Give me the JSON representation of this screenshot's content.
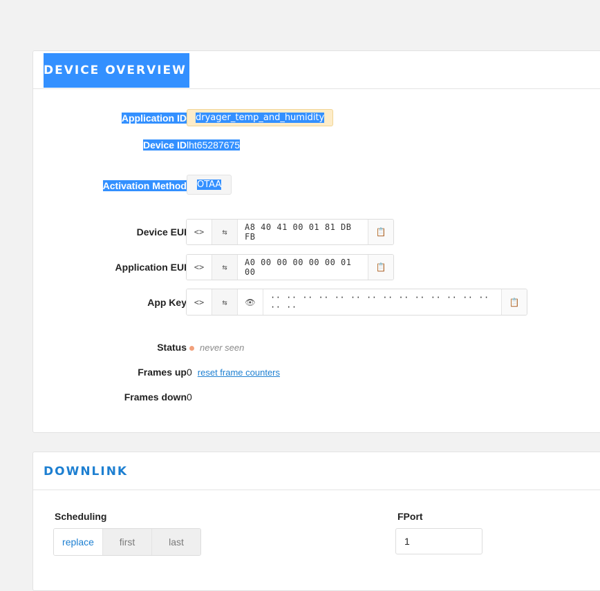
{
  "overview": {
    "title": "DEVICE OVERVIEW",
    "application_id": {
      "label": "Application ID",
      "value": "dryager_temp_and_humidity"
    },
    "device_id": {
      "label": "Device ID",
      "value": "lht65287675"
    },
    "activation": {
      "label": "Activation Method",
      "value": "OTAA"
    },
    "device_eui": {
      "label": "Device EUI",
      "value": "A8 40 41 00 01 81 DB FB"
    },
    "application_eui": {
      "label": "Application EUI",
      "value": "A0 00 00 00 00 00 01 00"
    },
    "app_key": {
      "label": "App Key",
      "value": "·· ·· ·· ·· ·· ·· ·· ·· ·· ·· ·· ·· ·· ·· ·· ··"
    },
    "status": {
      "label": "Status",
      "value": "never seen"
    },
    "frames_up": {
      "label": "Frames up",
      "value": "0",
      "reset_link": "reset frame counters"
    },
    "frames_down": {
      "label": "Frames down",
      "value": "0"
    },
    "icons": {
      "toggle_format": "<>",
      "swap": "⇆",
      "reveal": "👁",
      "copy": "📋"
    }
  },
  "downlink": {
    "title": "DOWNLINK",
    "scheduling": {
      "label": "Scheduling",
      "options": [
        "replace",
        "first",
        "last"
      ],
      "selected": "replace"
    },
    "fport": {
      "label": "FPort",
      "value": "1"
    }
  }
}
